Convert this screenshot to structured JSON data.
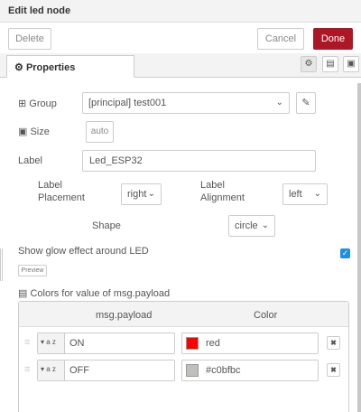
{
  "dialog": {
    "title": "Edit led node",
    "buttons": {
      "delete": "Delete",
      "cancel": "Cancel",
      "done": "Done"
    },
    "done_color": "#ad1625"
  },
  "tabs": {
    "properties": "Properties",
    "icons": [
      "gear-icon",
      "document-icon",
      "layout-icon"
    ]
  },
  "form": {
    "group": {
      "label": "Group",
      "value": "[principal] test001"
    },
    "size": {
      "label": "Size",
      "value": "auto"
    },
    "label_field": {
      "label": "Label",
      "value": "Led_ESP32"
    },
    "label_placement": {
      "label_line1": "Label",
      "label_line2": "Placement",
      "value": "right"
    },
    "label_alignment": {
      "label_line1": "Label",
      "label_line2": "Alignment",
      "value": "left"
    },
    "shape": {
      "label": "Shape",
      "value": "circle"
    },
    "glow": {
      "label": "Show glow effect around LED",
      "checked": true
    },
    "preview_label": "Preview",
    "colors_label": "Colors for value of msg.payload"
  },
  "color_table": {
    "headers": [
      "msg.payload",
      "Color"
    ],
    "rows": [
      {
        "type": "a z",
        "value": "ON",
        "color_name": "red",
        "swatch": "#ff0000"
      },
      {
        "type": "a z",
        "value": "OFF",
        "color_name": "#c0bfbc",
        "swatch": "#c0bfbc"
      }
    ]
  }
}
